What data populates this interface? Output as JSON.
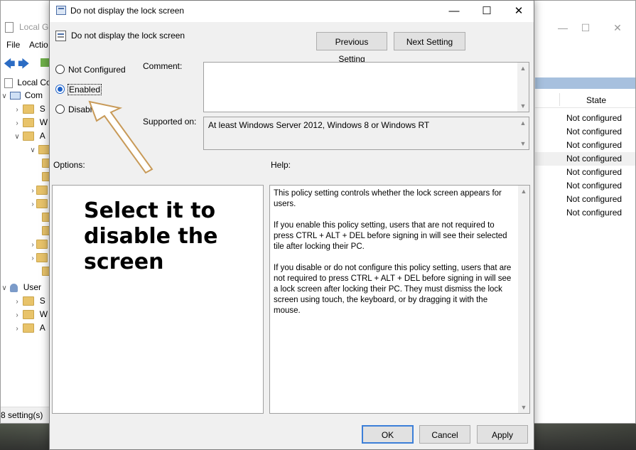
{
  "background_window": {
    "title": "Local Gr",
    "menu": [
      "File",
      "Actio"
    ],
    "tree": [
      {
        "label": "Local Co"
      },
      {
        "label": "Com"
      },
      {
        "label": "S"
      },
      {
        "label": "W"
      },
      {
        "label": "A"
      },
      {
        "label": "User"
      },
      {
        "label": "S"
      },
      {
        "label": "W"
      },
      {
        "label": "A"
      }
    ],
    "state_header": "State",
    "state_values": [
      "Not configured",
      "Not configured",
      "Not configured",
      "Not configured",
      "Not configured",
      "Not configured",
      "Not configured",
      "Not configured"
    ],
    "status": "8 setting(s)"
  },
  "dialog": {
    "title": "Do not display the lock screen",
    "policy_name": "Do not display the lock screen",
    "previous_label": "Previous Setting",
    "next_label": "Next Setting",
    "options": {
      "not_configured": "Not Configured",
      "enabled": "Enabled",
      "disabled": "Disabled",
      "selected": "enabled"
    },
    "comment_label": "Comment:",
    "comment_value": "",
    "supported_label": "Supported on:",
    "supported_value": "At least Windows Server 2012, Windows 8 or Windows RT",
    "options_label": "Options:",
    "help_label": "Help:",
    "help_paragraphs": [
      "This policy setting controls whether the lock screen appears for users.",
      "If you enable this policy setting, users that are not required to press CTRL + ALT + DEL before signing in will see their selected tile after  locking their PC.",
      "If you disable or do not configure this policy setting, users that are not required to press CTRL + ALT + DEL before signing in will see a lock screen after locking their PC. They must dismiss the lock screen using touch, the keyboard, or by dragging it with the mouse."
    ],
    "ok_label": "OK",
    "cancel_label": "Cancel",
    "apply_label": "Apply"
  },
  "annotation": {
    "lines": [
      "Select it to",
      "disable the",
      "screen"
    ],
    "arrow_color": "#c89a58"
  }
}
